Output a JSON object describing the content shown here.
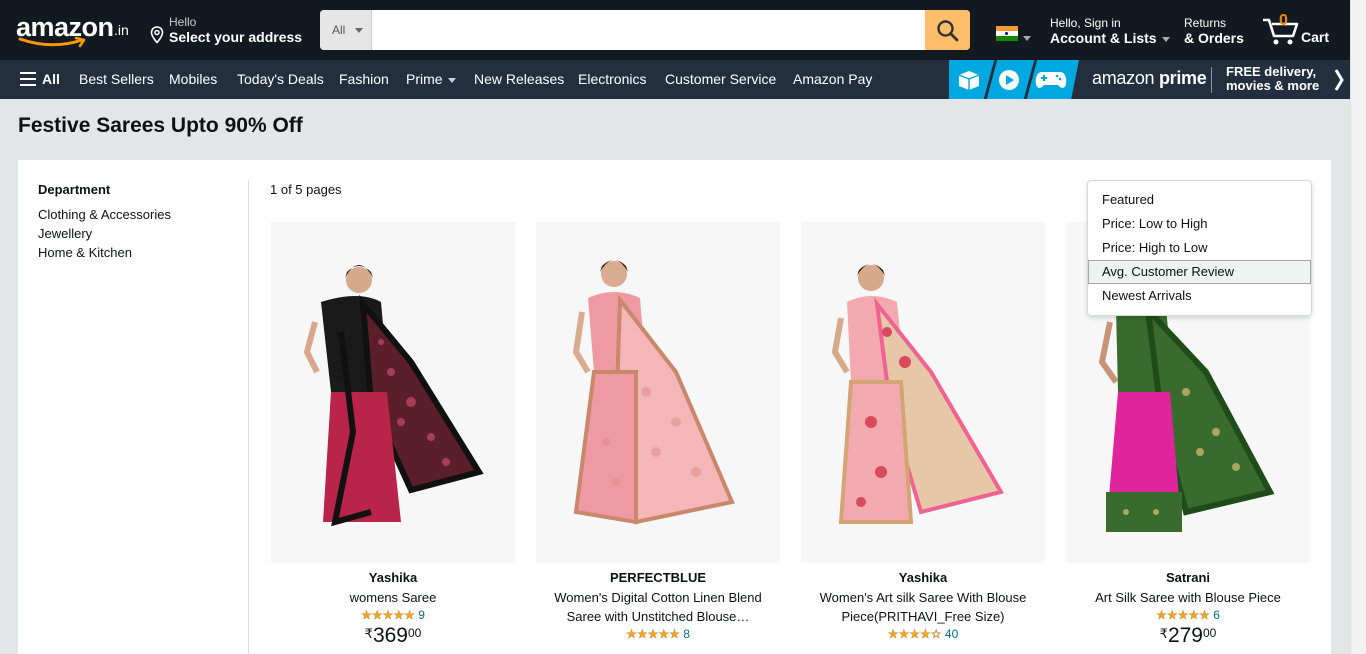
{
  "header": {
    "logo_text": "amazon",
    "logo_tld": ".in",
    "address_hello": "Hello",
    "address_label": "Select your address",
    "search_category": "All",
    "search_placeholder": "",
    "account_hello": "Hello, Sign in",
    "account_label": "Account & Lists",
    "returns_l1": "Returns",
    "returns_l2": "& Orders",
    "cart_count": "0",
    "cart_label": "Cart"
  },
  "nav": {
    "all_label": "All",
    "links": [
      "Best Sellers",
      "Mobiles",
      "Today's Deals",
      "Fashion",
      "Prime",
      "New Releases",
      "Electronics",
      "Customer Service",
      "Amazon Pay"
    ],
    "prime_logo_a": "amazon",
    "prime_logo_b": "prime",
    "prime_text_l1": "FREE delivery,",
    "prime_text_l2": "movies & more"
  },
  "page": {
    "title": "Festive Sarees Upto 90% Off",
    "department_title": "Department",
    "departments": [
      "Clothing & Accessories",
      "Jewellery",
      "Home & Kitchen"
    ],
    "pagination": "1 of 5 pages"
  },
  "sort_menu": {
    "options": [
      "Featured",
      "Price: Low to High",
      "Price: High to Low",
      "Avg. Customer Review",
      "Newest Arrivals"
    ],
    "highlighted": "Avg. Customer Review"
  },
  "products": [
    {
      "brand": "Yashika",
      "title": "womens Saree",
      "rating": 5,
      "reviews": "9",
      "currency": "₹",
      "price_whole": "369",
      "price_fraction": "00",
      "colors": {
        "main": "#5a1f2a",
        "accent": "#b8244a",
        "border": "#111111"
      }
    },
    {
      "brand": "PERFECTBLUE",
      "title": "Women's Digital Cotton Linen Blend Saree with Unstitched Blouse…",
      "rating": 5,
      "reviews": "8",
      "currency": "",
      "price_whole": "",
      "price_fraction": "",
      "colors": {
        "main": "#ef9aa3",
        "accent": "#f4b6b6",
        "border": "#c9876b"
      }
    },
    {
      "brand": "Yashika",
      "title": "Women's Art silk Saree With Blouse Piece(PRITHAVI_Free Size)",
      "rating": 4.5,
      "reviews": "40",
      "currency": "",
      "price_whole": "",
      "price_fraction": "",
      "colors": {
        "main": "#f2a9b0",
        "accent": "#d94a5a",
        "border": "#d4a574"
      }
    },
    {
      "brand": "Satrani",
      "title": "Art Silk Saree with Blouse Piece",
      "rating": 5,
      "reviews": "6",
      "currency": "₹",
      "price_whole": "279",
      "price_fraction": "00",
      "colors": {
        "main": "#3a6b2e",
        "accent": "#e0249c",
        "border": "#1f4d1a"
      }
    }
  ]
}
